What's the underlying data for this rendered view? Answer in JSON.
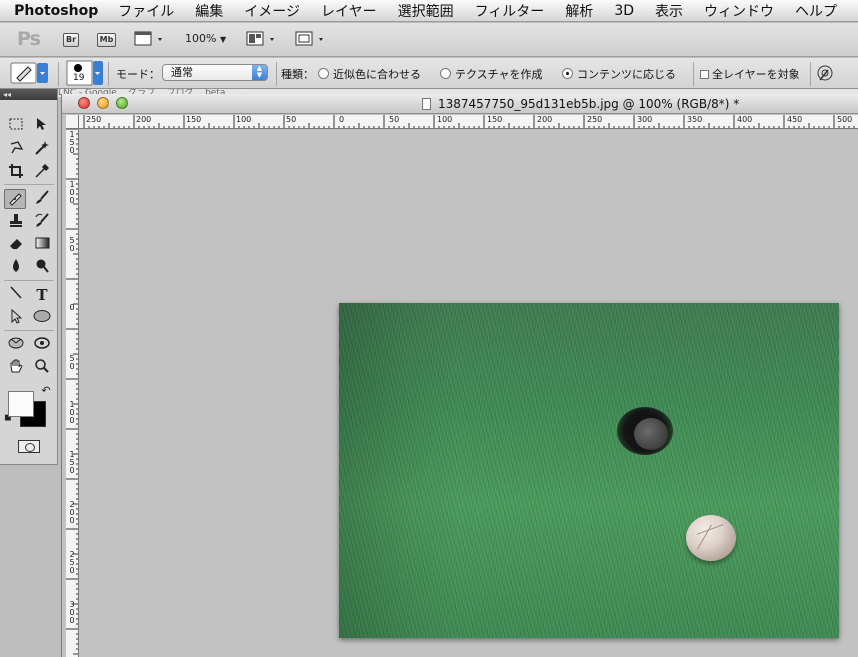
{
  "menubar": {
    "apple_icon": "apple-icon",
    "app_name": "Photoshop",
    "items": [
      "ファイル",
      "編集",
      "イメージ",
      "レイヤー",
      "選択範囲",
      "フィルター",
      "解析",
      "3D",
      "表示",
      "ウィンドウ",
      "ヘルプ"
    ]
  },
  "appbar": {
    "logo": "Ps",
    "bridge": "Br",
    "minibridge": "Mb",
    "zoom": "100%",
    "arrange_icon": "view-extras-icon",
    "screen_mode_icon": "screen-mode-icon"
  },
  "options": {
    "brush_size": "19",
    "mode_label": "モード：",
    "mode_value": "通常",
    "type_label": "種類：",
    "radio_proximity": "近似色に合わせる",
    "radio_texture": "テクスチャを作成",
    "radio_content_aware": "コンテンツに応じる",
    "sample_all_layers": "全レイヤーを対象",
    "selected_type": "コンテンツに応じる"
  },
  "tab_strip_text": "LNC - Google... グラフ... ブログ... beta ... ...",
  "document": {
    "title": "1387457750_95d131eb5b.jpg @ 100% (RGB/8*) *",
    "hruler_labels": [
      "250",
      "200",
      "150",
      "100",
      "50",
      "0",
      "50",
      "100",
      "150",
      "200",
      "250",
      "300",
      "350",
      "400",
      "450",
      "500"
    ],
    "vruler_labels": [
      "1\n5\n0",
      "1\n0\n0",
      "5\n0",
      "0",
      "5\n0",
      "1\n0\n0",
      "1\n5\n0",
      "2\n0\n0",
      "2\n5\n0",
      "3\n0\n0"
    ]
  },
  "colors": {
    "foreground": "#fbfbfb",
    "background": "#000000",
    "canvas_bg": "#c2c2c2"
  }
}
